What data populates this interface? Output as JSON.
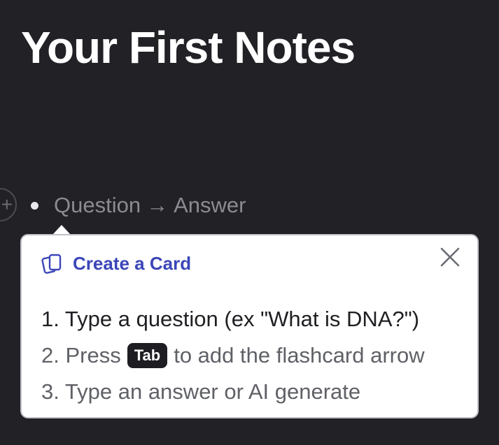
{
  "page": {
    "title": "Your First Notes"
  },
  "editor": {
    "add_icon": "plus-icon",
    "bullet": {
      "question_placeholder": "Question",
      "arrow": "→",
      "answer_placeholder": "Answer"
    }
  },
  "tooltip": {
    "icon": "cards-icon",
    "title": "Create a Card",
    "close_icon": "close-icon",
    "steps": {
      "step1": "1. Type a question (ex \"What is DNA?\")",
      "step2_before": "2. Press",
      "step2_key": "Tab",
      "step2_after": "to add the flashcard arrow",
      "step3": "3. Type an answer or AI generate"
    }
  },
  "colors": {
    "background": "#212126",
    "accent": "#3b46b8",
    "tooltip_background": "#ffffff"
  }
}
